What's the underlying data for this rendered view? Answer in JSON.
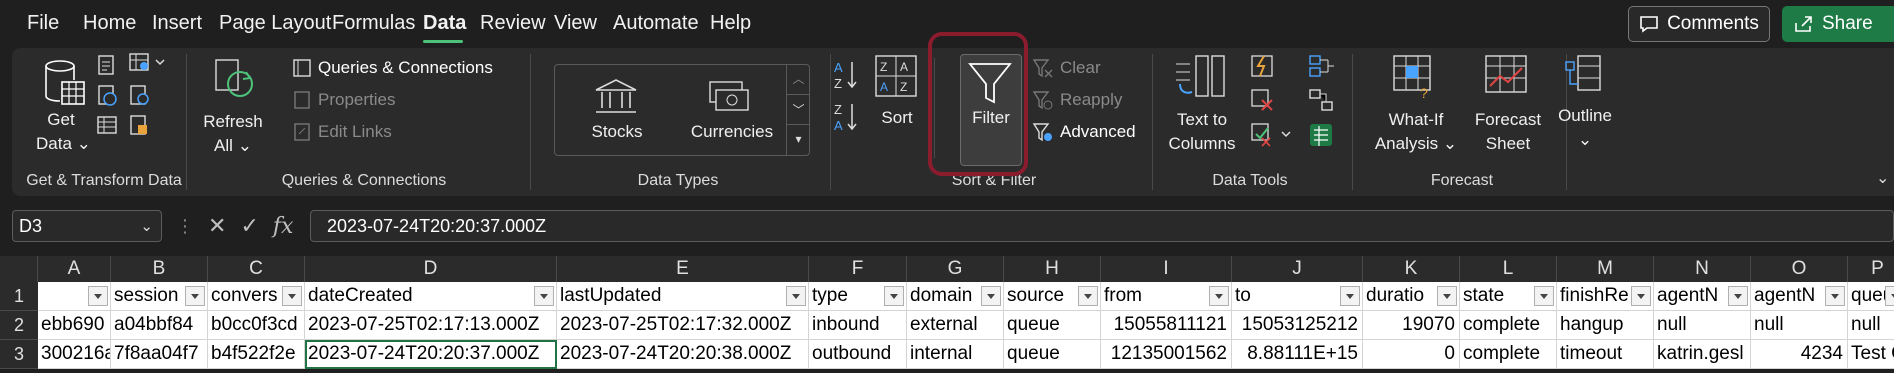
{
  "menu": {
    "tabs": [
      "File",
      "Home",
      "Insert",
      "Page Layout",
      "Formulas",
      "Data",
      "Review",
      "View",
      "Automate",
      "Help"
    ],
    "active_tab": "Data",
    "comments_label": "Comments",
    "share_label": "Share"
  },
  "ribbon": {
    "get_transform": {
      "get_data_line1": "Get",
      "get_data_line2": "Data",
      "group_label": "Get & Transform Data"
    },
    "queries": {
      "refresh_line1": "Refresh",
      "refresh_line2": "All",
      "queries_connections": "Queries & Connections",
      "properties": "Properties",
      "edit_links": "Edit Links",
      "group_label": "Queries & Connections"
    },
    "data_types": {
      "stocks": "Stocks",
      "currencies": "Currencies",
      "group_label": "Data Types"
    },
    "sort_filter": {
      "sort": "Sort",
      "filter": "Filter",
      "clear": "Clear",
      "reapply": "Reapply",
      "advanced": "Advanced",
      "group_label": "Sort & Filter"
    },
    "data_tools": {
      "text_to_columns_line1": "Text to",
      "text_to_columns_line2": "Columns",
      "group_label": "Data Tools"
    },
    "forecast": {
      "what_if_line1": "What-If",
      "what_if_line2": "Analysis",
      "forecast_sheet_line1": "Forecast",
      "forecast_sheet_line2": "Sheet",
      "group_label": "Forecast"
    },
    "outline": {
      "label": "Outline"
    }
  },
  "formula_bar": {
    "name_box": "D3",
    "formula": "2023-07-24T20:20:37.000Z"
  },
  "grid": {
    "columns": [
      "A",
      "B",
      "C",
      "D",
      "E",
      "F",
      "G",
      "H",
      "I",
      "J",
      "K",
      "L",
      "M",
      "N",
      "O",
      "P"
    ],
    "row_numbers": [
      "1",
      "2",
      "3"
    ],
    "header_row": [
      "",
      "session",
      "convers",
      "dateCreated",
      "lastUpdated",
      "type",
      "domain",
      "source",
      "from",
      "to",
      "duratio",
      "state",
      "finishRe",
      "agentN",
      "agentN",
      "queue"
    ],
    "rows": [
      [
        "ebb690",
        "a04bbf84",
        "b0cc0f3cd",
        "2023-07-25T02:17:13.000Z",
        "2023-07-25T02:17:32.000Z",
        "inbound",
        "external",
        "queue",
        "15055811121",
        "15053125212",
        "19070",
        "complete",
        "hangup",
        "null",
        "null",
        "null"
      ],
      [
        "300216a",
        "7f8aa04f7",
        "b4f522f2e",
        "2023-07-24T20:20:37.000Z",
        "2023-07-24T20:20:38.000Z",
        "outbound",
        "internal",
        "queue",
        "12135001562",
        "8.88111E+15",
        "0",
        "complete",
        "timeout",
        "katrin.gesl",
        "4234",
        "Test C"
      ]
    ]
  },
  "colors": {
    "accent_green": "#1e7b46",
    "highlight_red": "#8b1c2e"
  }
}
